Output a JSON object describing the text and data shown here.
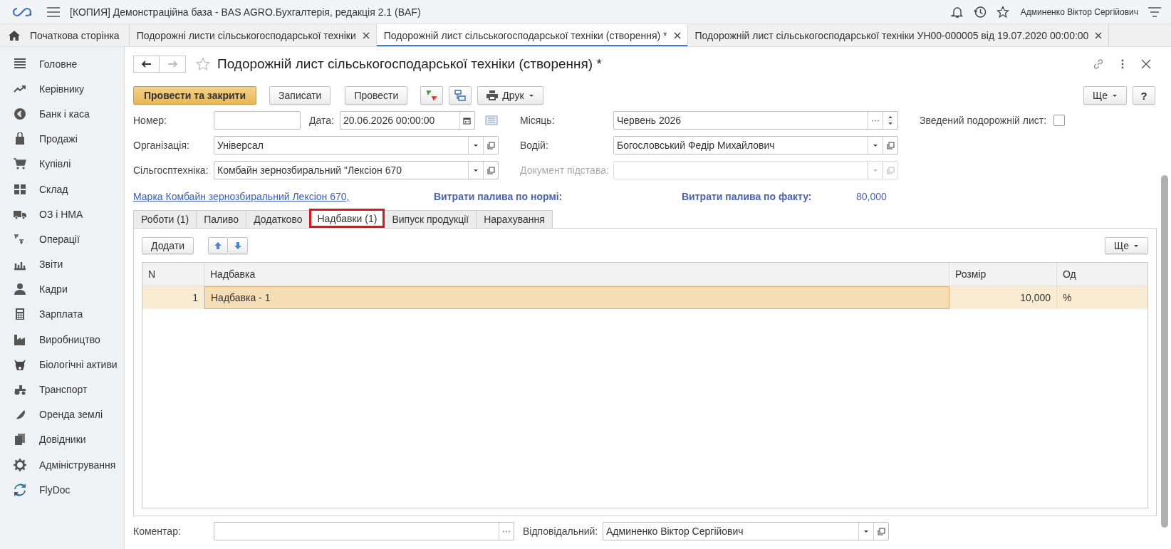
{
  "window": {
    "title": "[КОПИЯ] Демонстраційна база - BAS AGRO.Бухгалтерія, редакція 2.1  (BAF)",
    "user": "Админенко Віктор Сергійович"
  },
  "open_tabs": [
    {
      "label": "Початкова сторінка",
      "kind": "home",
      "selected": false
    },
    {
      "label": "Подорожні листи сільськогосподарської техніки",
      "kind": "doc",
      "selected": false
    },
    {
      "label": "Подорожній лист сільськогосподарської техніки (створення) *",
      "kind": "doc",
      "selected": true
    },
    {
      "label": "Подорожній лист сільськогосподарської техніки УН00-000005 від 19.07.2020 00:00:00",
      "kind": "doc",
      "selected": false
    }
  ],
  "sidebar": {
    "items": [
      {
        "label": "Головне"
      },
      {
        "label": "Керівнику"
      },
      {
        "label": "Банк і каса"
      },
      {
        "label": "Продажі"
      },
      {
        "label": "Купівлі"
      },
      {
        "label": "Склад"
      },
      {
        "label": "ОЗ і НМА"
      },
      {
        "label": "Операції"
      },
      {
        "label": "Звіти"
      },
      {
        "label": "Кадри"
      },
      {
        "label": "Зарплата"
      },
      {
        "label": "Виробництво"
      },
      {
        "label": "Біологічні активи"
      },
      {
        "label": "Транспорт"
      },
      {
        "label": "Оренда землі"
      },
      {
        "label": "Довідники"
      },
      {
        "label": "Адміністрування"
      },
      {
        "label": "FlyDoc"
      }
    ]
  },
  "form": {
    "title": "Подорожній лист сільськогосподарської техніки (створення) *",
    "buttons": [
      {
        "label": "Провести та закрити",
        "kind": "primary"
      },
      {
        "label": "Записати",
        "kind": "plain"
      },
      {
        "label": "Провести",
        "kind": "plain"
      },
      {
        "label": "Друк",
        "kind": "menu"
      }
    ],
    "more_button": "Ще",
    "help_button": "?",
    "number": {
      "label": "Номер:"
    },
    "date": {
      "label": "Дата:",
      "value": "20.06.2026 00:00:00"
    },
    "month": {
      "label": "Місяць:",
      "value": "Червень 2026"
    },
    "summary": {
      "label": "Зведений подорожній лист:",
      "checked": false
    },
    "organization": {
      "label": "Організація:",
      "value": "Універсал",
      "disabled": false
    },
    "driver": {
      "label": "Водій:",
      "value": "Богословський Федір Михайлович",
      "disabled": false
    },
    "machine": {
      "label": "Сільгосптехніка:",
      "value": "Комбайн зернозбиральний \"Лексіон 670",
      "disabled": false
    },
    "basis": {
      "label": "Документ підстава:",
      "disabled": true
    },
    "brand_link": "Марка Комбайн зернозбиральний Лексіон 670, ",
    "fuel_norm": {
      "label": "Витрати палива по нормі:"
    },
    "fuel_fact": {
      "label": "Витрати палива по факту:",
      "value": "80,000"
    },
    "tabs": [
      {
        "label": "Роботи (1)",
        "selected": false
      },
      {
        "label": "Паливо",
        "selected": false
      },
      {
        "label": "Додатково",
        "selected": false
      },
      {
        "label": "Надбавки (1)",
        "selected": true
      },
      {
        "label": "Випуск продукції",
        "selected": false
      },
      {
        "label": "Нарахування",
        "selected": false
      }
    ],
    "table_toolbar": {
      "add_button": "Додати",
      "more_button": "Ще"
    },
    "table": {
      "columns": [
        "N",
        "Надбавка",
        "Розмір",
        "Од"
      ],
      "rows": [
        {
          "cells": [
            "1",
            "Надбавка - 1",
            "10,000",
            "%"
          ],
          "selected": true
        }
      ]
    },
    "comment": {
      "label": "Коментар:"
    },
    "responsible": {
      "label": "Відповідальний:",
      "value": "Админенко Віктор Сергійович"
    }
  }
}
